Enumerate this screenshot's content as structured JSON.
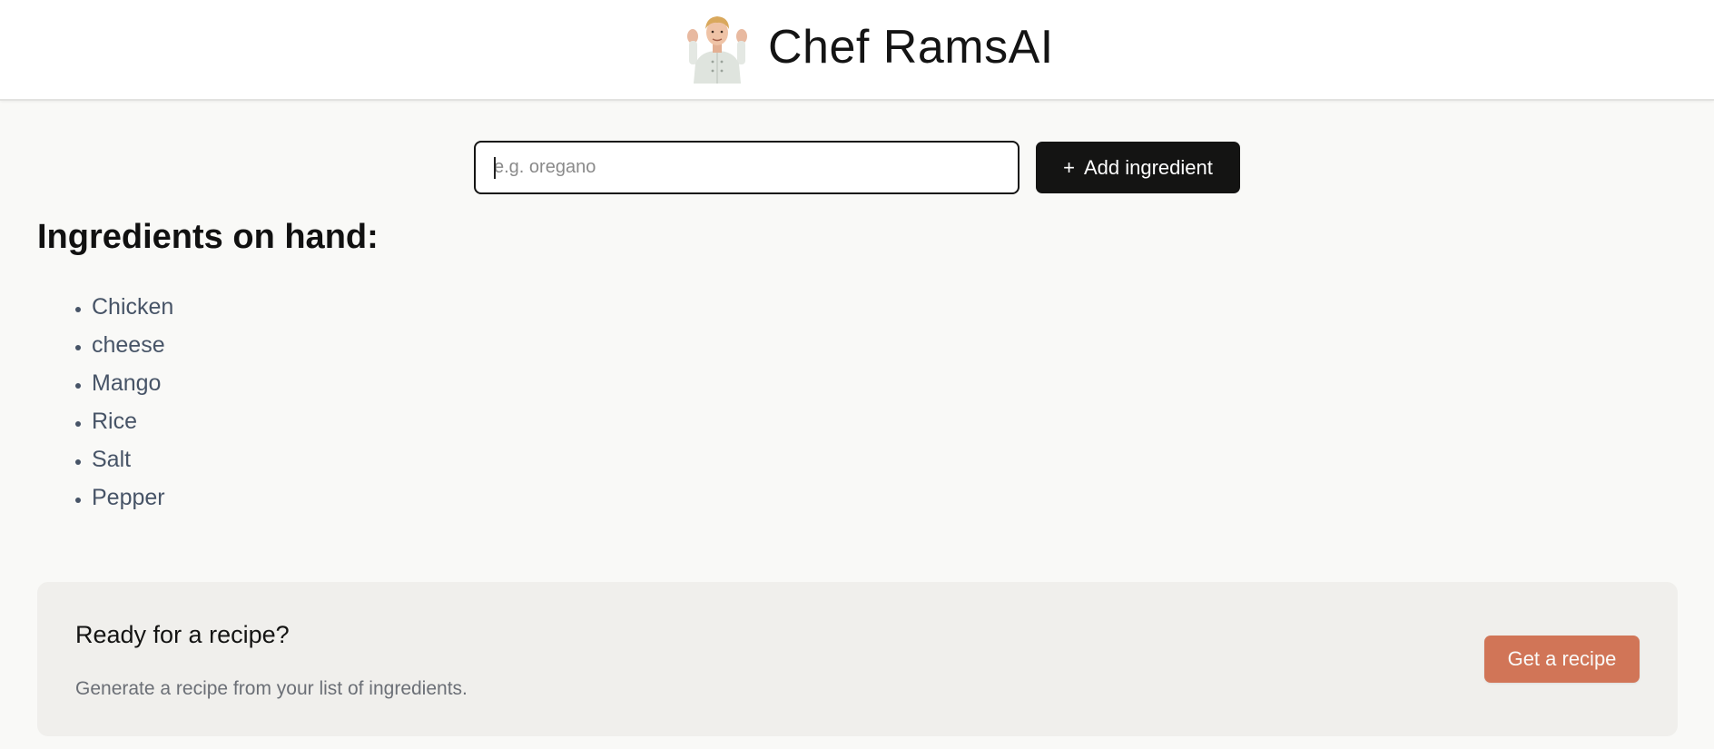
{
  "header": {
    "title": "Chef RamsAI",
    "logo_icon": "chef-avatar-icon"
  },
  "form": {
    "input_placeholder": "e.g. oregano",
    "input_value": "",
    "add_button_icon": "+",
    "add_button_label": "Add ingredient"
  },
  "ingredients": {
    "heading": "Ingredients on hand:",
    "items": [
      "Chicken",
      "cheese",
      "Mango",
      "Rice",
      "Salt",
      "Pepper"
    ]
  },
  "recipe_cta": {
    "title": "Ready for a recipe?",
    "description": "Generate a recipe from your list of ingredients.",
    "button_label": "Get a recipe"
  },
  "colors": {
    "page_background": "#f9f9f7",
    "header_background": "#ffffff",
    "primary_button": "#141413",
    "accent_button": "#d17557",
    "card_background": "#f0efec",
    "list_text": "#475467"
  }
}
